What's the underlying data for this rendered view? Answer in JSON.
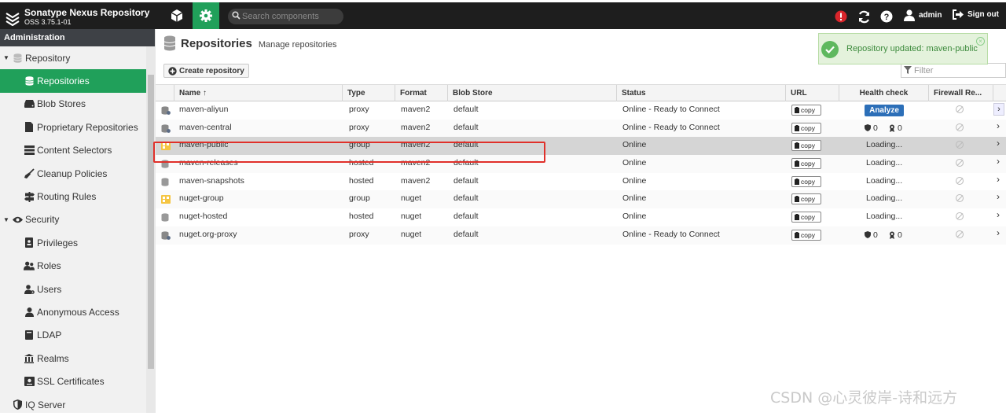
{
  "header": {
    "brand_name": "Sonatype Nexus Repository",
    "brand_version": "OSS 3.75.1-01",
    "search_placeholder": "Search components",
    "user": "admin",
    "sign_out": "Sign out"
  },
  "sidebar": {
    "title": "Administration",
    "items": [
      {
        "label": "Repository",
        "icon": "database-icon",
        "group": true,
        "active": false
      },
      {
        "label": "Repositories",
        "icon": "database-icon",
        "group": false,
        "active": true
      },
      {
        "label": "Blob Stores",
        "icon": "hdd-icon",
        "group": false,
        "active": false
      },
      {
        "label": "Proprietary Repositories",
        "icon": "document-icon",
        "group": false,
        "active": false
      },
      {
        "label": "Content Selectors",
        "icon": "layers-icon",
        "group": false,
        "active": false
      },
      {
        "label": "Cleanup Policies",
        "icon": "broom-icon",
        "group": false,
        "active": false
      },
      {
        "label": "Routing Rules",
        "icon": "signpost-icon",
        "group": false,
        "active": false
      },
      {
        "label": "Security",
        "icon": "eye-icon",
        "group": true,
        "active": false
      },
      {
        "label": "Privileges",
        "icon": "id-badge-icon",
        "group": false,
        "active": false
      },
      {
        "label": "Roles",
        "icon": "users-icon",
        "group": false,
        "active": false
      },
      {
        "label": "Users",
        "icon": "user-cog-icon",
        "group": false,
        "active": false
      },
      {
        "label": "Anonymous Access",
        "icon": "user-icon",
        "group": false,
        "active": false
      },
      {
        "label": "LDAP",
        "icon": "book-icon",
        "group": false,
        "active": false
      },
      {
        "label": "Realms",
        "icon": "realm-icon",
        "group": false,
        "active": false
      },
      {
        "label": "SSL Certificates",
        "icon": "certificate-icon",
        "group": false,
        "active": false
      },
      {
        "label": "IQ Server",
        "icon": "shield-icon",
        "group": true,
        "active": false
      }
    ]
  },
  "page": {
    "title": "Repositories",
    "subtitle": "Manage repositories",
    "create_button": "Create repository",
    "filter_placeholder": "Filter"
  },
  "toast": {
    "message": "Repository updated: maven-public"
  },
  "grid": {
    "columns": [
      "Name ↑",
      "Type",
      "Format",
      "Blob Store",
      "Status",
      "URL",
      "Health check",
      "Firewall Re..."
    ],
    "copy_label": "copy",
    "analyze_label": "Analyze",
    "rows": [
      {
        "name": "maven-aliyun",
        "type": "proxy",
        "format": "maven2",
        "blob": "default",
        "status": "Online - Ready to Connect",
        "health": "analyze",
        "h1": "",
        "h2": "",
        "selected": false
      },
      {
        "name": "maven-central",
        "type": "proxy",
        "format": "maven2",
        "blob": "default",
        "status": "Online - Ready to Connect",
        "health": "counts",
        "h1": "0",
        "h2": "0",
        "selected": false
      },
      {
        "name": "maven-public",
        "type": "group",
        "format": "maven2",
        "blob": "default",
        "status": "Online",
        "health": "Loading...",
        "h1": "",
        "h2": "",
        "selected": true
      },
      {
        "name": "maven-releases",
        "type": "hosted",
        "format": "maven2",
        "blob": "default",
        "status": "Online",
        "health": "Loading...",
        "h1": "",
        "h2": "",
        "selected": false
      },
      {
        "name": "maven-snapshots",
        "type": "hosted",
        "format": "maven2",
        "blob": "default",
        "status": "Online",
        "health": "Loading...",
        "h1": "",
        "h2": "",
        "selected": false
      },
      {
        "name": "nuget-group",
        "type": "group",
        "format": "nuget",
        "blob": "default",
        "status": "Online",
        "health": "Loading...",
        "h1": "",
        "h2": "",
        "selected": false
      },
      {
        "name": "nuget-hosted",
        "type": "hosted",
        "format": "nuget",
        "blob": "default",
        "status": "Online",
        "health": "Loading...",
        "h1": "",
        "h2": "",
        "selected": false
      },
      {
        "name": "nuget.org-proxy",
        "type": "proxy",
        "format": "nuget",
        "blob": "default",
        "status": "Online - Ready to Connect",
        "health": "counts",
        "h1": "0",
        "h2": "0",
        "selected": false
      }
    ]
  },
  "watermark": "CSDN @心灵彼岸-诗和远方",
  "colors": {
    "accent": "#20a05a",
    "header_bg": "#1e1e1e",
    "highlight": "#e0302a",
    "analyze": "#2c6fb8"
  }
}
